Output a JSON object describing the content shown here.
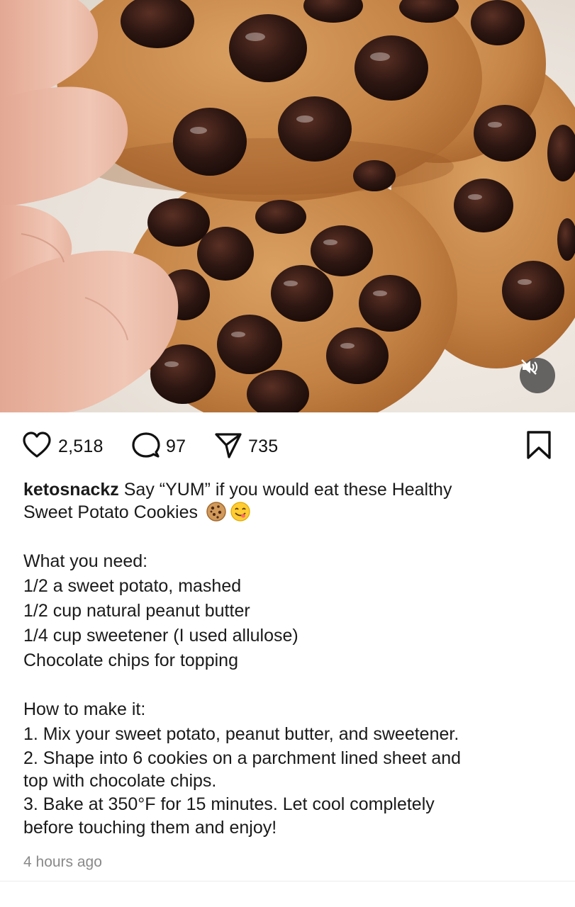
{
  "post": {
    "username": "ketosnackz",
    "caption_lines": [
      "Say “YUM” if you would eat these Healthy",
      "Sweet Potato Cookies"
    ],
    "emojis": [
      "cookie-emoji",
      "yum-face-emoji"
    ],
    "ingredients_heading": "What you need:",
    "ingredients": [
      "1/2 a sweet potato, mashed",
      "1/2 cup natural peanut butter",
      "1/4 cup sweetener (I used allulose)",
      "Chocolate chips for topping"
    ],
    "steps_heading": "How to make it:",
    "steps": [
      "1. Mix your sweet potato, peanut butter, and sweetener.",
      "2. Shape into 6 cookies on a parchment lined sheet and",
      "top with chocolate chips.",
      "3. Bake at 350°F for 15 minutes. Let cool completely",
      "before touching them and enjoy!"
    ],
    "timestamp": "4 hours ago"
  },
  "actions": {
    "likes": "2,518",
    "comments": "97",
    "shares": "735",
    "like_icon": "heart-icon",
    "comment_icon": "comment-bubble-icon",
    "share_icon": "paper-plane-icon",
    "save_icon": "bookmark-icon"
  },
  "media": {
    "mute_icon": "speaker-muted-icon",
    "colors": {
      "cookie": "#c98a4a",
      "chip": "#2a1410",
      "skin": "#e8b8a4"
    }
  }
}
